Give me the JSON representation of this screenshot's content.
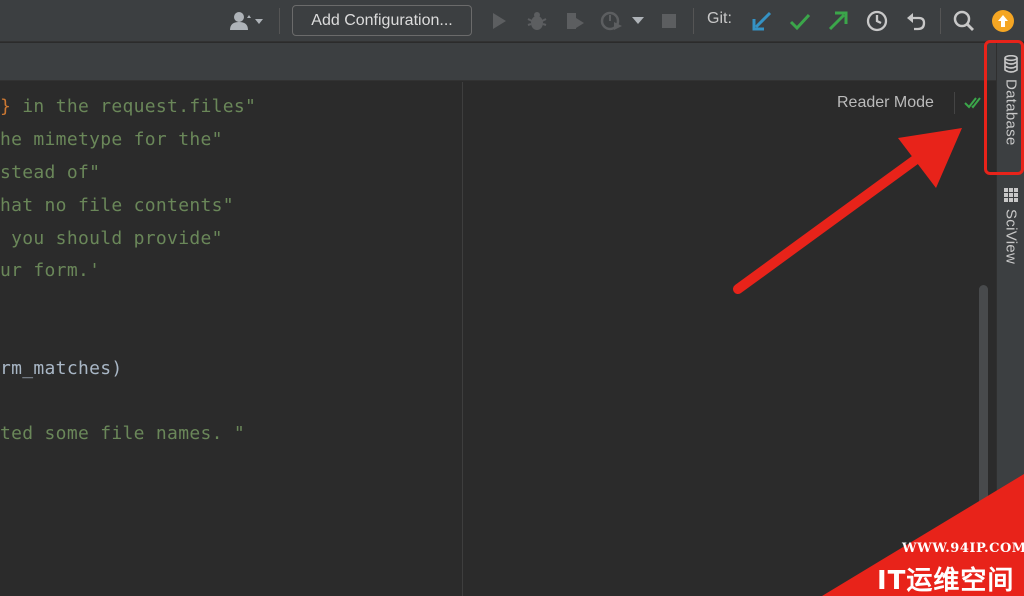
{
  "toolbar": {
    "run_configuration_label": "Add Configuration...",
    "git_label": "Git:",
    "icons": [
      "user-icon",
      "run-icon",
      "debug-icon",
      "coverage-icon",
      "profile-icon",
      "stop-icon",
      "git-update-icon",
      "git-commit-icon",
      "git-push-icon",
      "history-icon",
      "rollback-icon",
      "search-icon",
      "update-icon"
    ],
    "colors": {
      "git_update": "#3592c4",
      "git_commit": "#3ba64a",
      "git_push": "#3ba64a",
      "update_badge": "#f5a623"
    }
  },
  "editor": {
    "lines": [
      {
        "before": "",
        "brace": "}",
        "after": " in the request.files\""
      },
      {
        "before": "he mimetype for the\"",
        "brace": "",
        "after": ""
      },
      {
        "before": "stead of\"",
        "brace": "",
        "after": ""
      },
      {
        "before": "hat no file contents\"",
        "brace": "",
        "after": ""
      },
      {
        "before": " you should provide\"",
        "brace": "",
        "after": ""
      },
      {
        "before": "ur form.'",
        "brace": "",
        "after": ""
      },
      {
        "before": "rm_matches)",
        "brace": "",
        "after": ""
      },
      {
        "before": "ted some file names. \"",
        "brace": "",
        "after": ""
      }
    ]
  },
  "preview": {
    "reader_mode_label": "Reader Mode"
  },
  "tool_strip": {
    "database_label": "Database",
    "sciview_label": "SciView"
  },
  "annotation": {
    "highlight_color": "#e8231a"
  },
  "watermark": {
    "url": "WWW.94IP.COM",
    "name": "IT运维空间"
  }
}
